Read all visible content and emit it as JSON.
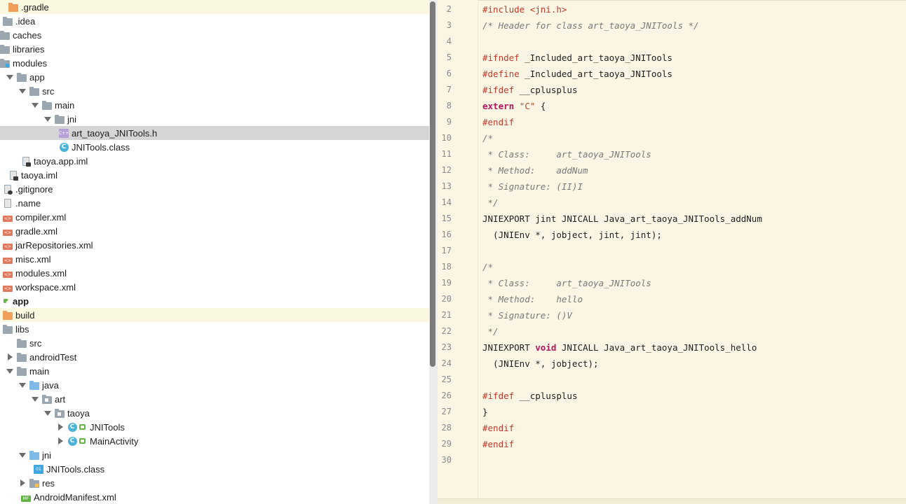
{
  "tree": {
    "rows": [
      {
        "label": ".gradle",
        "icon": "folder-orange-icon"
      },
      {
        "label": ".idea",
        "icon": "folder-icon"
      },
      {
        "label": "caches",
        "icon": "folder-icon"
      },
      {
        "label": "libraries",
        "icon": "folder-icon"
      },
      {
        "label": "modules",
        "icon": "module-folder-icon"
      },
      {
        "label": "app",
        "icon": "folder-icon"
      },
      {
        "label": "src",
        "icon": "folder-icon"
      },
      {
        "label": "main",
        "icon": "folder-icon"
      },
      {
        "label": "jni",
        "icon": "folder-icon"
      },
      {
        "label": "art_taoya_JNITools.h",
        "icon": "c-header-file-icon"
      },
      {
        "label": "JNITools.class",
        "icon": "class-file-icon"
      },
      {
        "label": "taoya.app.iml",
        "icon": "iml-file-icon"
      },
      {
        "label": "taoya.iml",
        "icon": "iml-file-icon"
      },
      {
        "label": ".gitignore",
        "icon": "ignore-file-icon"
      },
      {
        "label": ".name",
        "icon": "text-file-icon"
      },
      {
        "label": "compiler.xml",
        "icon": "xml-file-icon"
      },
      {
        "label": "gradle.xml",
        "icon": "xml-file-icon"
      },
      {
        "label": "jarRepositories.xml",
        "icon": "xml-file-icon"
      },
      {
        "label": "misc.xml",
        "icon": "xml-file-icon"
      },
      {
        "label": "modules.xml",
        "icon": "xml-file-icon"
      },
      {
        "label": "workspace.xml",
        "icon": "xml-file-icon"
      },
      {
        "label": "app",
        "icon": "module-icon"
      },
      {
        "label": "build",
        "icon": "folder-orange-icon"
      },
      {
        "label": "libs",
        "icon": "folder-icon"
      },
      {
        "label": "src",
        "icon": "folder-icon"
      },
      {
        "label": "androidTest",
        "icon": "folder-icon"
      },
      {
        "label": "main",
        "icon": "folder-icon"
      },
      {
        "label": "java",
        "icon": "source-folder-icon"
      },
      {
        "label": "art",
        "icon": "package-icon"
      },
      {
        "label": "taoya",
        "icon": "package-icon"
      },
      {
        "label": "JNITools",
        "icon": "class-icon"
      },
      {
        "label": "MainActivity",
        "icon": "class-icon"
      },
      {
        "label": "jni",
        "icon": "source-folder-icon"
      },
      {
        "label": "JNITools.class",
        "icon": "binary-class-icon"
      },
      {
        "label": "res",
        "icon": "resource-folder-icon"
      },
      {
        "label": "AndroidManifest.xml",
        "icon": "manifest-file-icon"
      }
    ]
  },
  "editor": {
    "file": "art_taoya_JNITools.h",
    "lines": [
      {
        "n": "2",
        "parts": [
          {
            "t": "#include <jni.h>",
            "k": "pp"
          }
        ]
      },
      {
        "n": "3",
        "parts": [
          {
            "t": "/* Header for class art_taoya_JNITools */",
            "k": "cm"
          }
        ]
      },
      {
        "n": "4",
        "parts": []
      },
      {
        "n": "5",
        "parts": [
          {
            "t": "#ifndef",
            "k": "pp"
          },
          {
            "t": " _Included_art_taoya_JNITools",
            "k": "plain"
          }
        ]
      },
      {
        "n": "6",
        "parts": [
          {
            "t": "#define",
            "k": "pp"
          },
          {
            "t": " _Included_art_taoya_JNITools",
            "k": "plain"
          }
        ]
      },
      {
        "n": "7",
        "parts": [
          {
            "t": "#ifdef",
            "k": "pp"
          },
          {
            "t": " __cplusplus",
            "k": "plain"
          }
        ]
      },
      {
        "n": "8",
        "parts": [
          {
            "t": "extern",
            "k": "kw"
          },
          {
            "t": " ",
            "k": "plain"
          },
          {
            "t": "\"C\"",
            "k": "str"
          },
          {
            "t": " {",
            "k": "plain"
          }
        ]
      },
      {
        "n": "9",
        "parts": [
          {
            "t": "#endif",
            "k": "pp"
          }
        ]
      },
      {
        "n": "10",
        "parts": [
          {
            "t": "/*",
            "k": "cm"
          }
        ]
      },
      {
        "n": "11",
        "parts": [
          {
            "t": " * Class:     art_taoya_JNITools",
            "k": "cm"
          }
        ]
      },
      {
        "n": "12",
        "parts": [
          {
            "t": " * Method:    addNum",
            "k": "cm"
          }
        ]
      },
      {
        "n": "13",
        "parts": [
          {
            "t": " * Signature: (II)I",
            "k": "cm"
          }
        ]
      },
      {
        "n": "14",
        "parts": [
          {
            "t": " */",
            "k": "cm"
          }
        ]
      },
      {
        "n": "15",
        "parts": [
          {
            "t": "JNIEXPORT jint JNICALL Java_art_taoya_JNITools_addNum",
            "k": "plain"
          }
        ]
      },
      {
        "n": "16",
        "parts": [
          {
            "t": "  (JNIEnv *, jobject, jint, jint);",
            "k": "plain"
          }
        ]
      },
      {
        "n": "17",
        "parts": []
      },
      {
        "n": "18",
        "parts": [
          {
            "t": "/*",
            "k": "cm"
          }
        ]
      },
      {
        "n": "19",
        "parts": [
          {
            "t": " * Class:     art_taoya_JNITools",
            "k": "cm"
          }
        ]
      },
      {
        "n": "20",
        "parts": [
          {
            "t": " * Method:    hello",
            "k": "cm"
          }
        ]
      },
      {
        "n": "21",
        "parts": [
          {
            "t": " * Signature: ()V",
            "k": "cm"
          }
        ]
      },
      {
        "n": "22",
        "parts": [
          {
            "t": " */",
            "k": "cm"
          }
        ]
      },
      {
        "n": "23",
        "parts": [
          {
            "t": "JNIEXPORT ",
            "k": "plain"
          },
          {
            "t": "void",
            "k": "kw"
          },
          {
            "t": " JNICALL Java_art_taoya_JNITools_hello",
            "k": "plain"
          }
        ]
      },
      {
        "n": "24",
        "parts": [
          {
            "t": "  (JNIEnv *, jobject);",
            "k": "plain"
          }
        ]
      },
      {
        "n": "25",
        "parts": []
      },
      {
        "n": "26",
        "parts": [
          {
            "t": "#ifdef",
            "k": "pp"
          },
          {
            "t": " __cplusplus",
            "k": "plain"
          }
        ]
      },
      {
        "n": "27",
        "parts": [
          {
            "t": "}",
            "k": "plain"
          }
        ]
      },
      {
        "n": "28",
        "parts": [
          {
            "t": "#endif",
            "k": "pp"
          }
        ]
      },
      {
        "n": "29",
        "parts": [
          {
            "t": "#endif",
            "k": "pp"
          }
        ]
      },
      {
        "n": "30",
        "parts": []
      }
    ]
  },
  "colors": {
    "editor_bg": "#fbf5e3",
    "selection": "#d5d5d5",
    "preprocessor": "#c0392b",
    "keyword": "#b0175b",
    "comment": "#7a7a7a"
  }
}
